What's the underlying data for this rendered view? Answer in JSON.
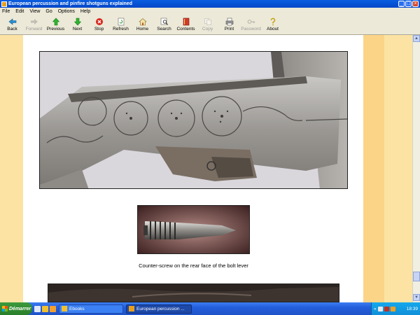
{
  "window": {
    "title": "European percussion and pinfire shotguns explained"
  },
  "menu": [
    "File",
    "Edit",
    "View",
    "Go",
    "Options",
    "Help"
  ],
  "toolbar": {
    "back": "Back",
    "forward": "Forward",
    "previous": "Previous",
    "next": "Next",
    "stop": "Stop",
    "refresh": "Refresh",
    "home": "Home",
    "search": "Search",
    "contents": "Contents",
    "copy": "Copy",
    "print": "Print",
    "password": "Password",
    "about": "About"
  },
  "content": {
    "caption": "Counter-screw on the rear face of the bolt lever"
  },
  "taskbar": {
    "start": "Démarrer",
    "tasks": [
      "Ebooks",
      "European percussion ..."
    ],
    "clock": "18:39"
  },
  "colors": {
    "page_background": "#ffffff",
    "band_light": "#fce3a3",
    "band_dark": "#fbd487",
    "titlebar": "#0a5ee0"
  }
}
